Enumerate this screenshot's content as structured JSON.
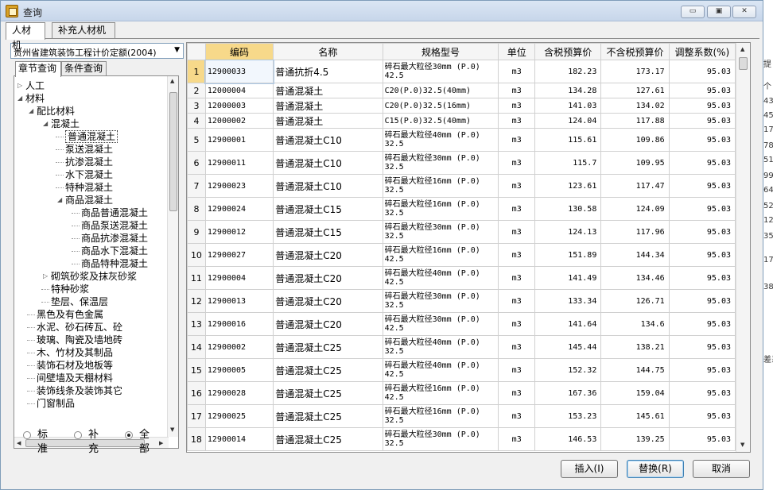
{
  "window": {
    "title": "查询",
    "controls": {
      "minimize": "▭",
      "maximize": "▣",
      "close": "✕"
    }
  },
  "top_tabs": [
    {
      "label": "人材机",
      "active": true
    },
    {
      "label": "补充人材机",
      "active": false
    }
  ],
  "left": {
    "dropdown_value": "贵州省建筑装饰工程计价定额(2004)",
    "sub_tabs": [
      {
        "label": "章节查询",
        "active": true
      },
      {
        "label": "条件查询",
        "active": false
      }
    ],
    "tree": [
      {
        "label": "人工",
        "level": 0,
        "expander": "▷"
      },
      {
        "label": "材料",
        "level": 0,
        "expander": "◢"
      },
      {
        "label": "配比材料",
        "level": 1,
        "expander": "◢"
      },
      {
        "label": "混凝土",
        "level": 2,
        "expander": "◢"
      },
      {
        "label": "普通混凝土",
        "level": 3,
        "expander": "",
        "selected": true
      },
      {
        "label": "泵送混凝土",
        "level": 3,
        "expander": ""
      },
      {
        "label": "抗渗混凝土",
        "level": 3,
        "expander": ""
      },
      {
        "label": "水下混凝土",
        "level": 3,
        "expander": ""
      },
      {
        "label": "特种混凝土",
        "level": 3,
        "expander": ""
      },
      {
        "label": "商品混凝土",
        "level": 3,
        "expander": "◢"
      },
      {
        "label": "商品普通混凝土",
        "level": 4,
        "expander": ""
      },
      {
        "label": "商品泵送混凝土",
        "level": 4,
        "expander": ""
      },
      {
        "label": "商品抗渗混凝土",
        "level": 4,
        "expander": ""
      },
      {
        "label": "商品水下混凝土",
        "level": 4,
        "expander": ""
      },
      {
        "label": "商品特种混凝土",
        "level": 4,
        "expander": ""
      },
      {
        "label": "砌筑砂浆及抹灰砂浆",
        "level": 2,
        "expander": "▷"
      },
      {
        "label": "特种砂浆",
        "level": 2,
        "expander": ""
      },
      {
        "label": "垫层、保温层",
        "level": 2,
        "expander": ""
      },
      {
        "label": "黑色及有色金属",
        "level": 1,
        "expander": ""
      },
      {
        "label": "水泥、砂石砖瓦、砼",
        "level": 1,
        "expander": ""
      },
      {
        "label": "玻璃、陶瓷及墙地砖",
        "level": 1,
        "expander": ""
      },
      {
        "label": "木、竹材及其制品",
        "level": 1,
        "expander": ""
      },
      {
        "label": "装饰石材及地板等",
        "level": 1,
        "expander": ""
      },
      {
        "label": "间壁墙及天棚材料",
        "level": 1,
        "expander": ""
      },
      {
        "label": "装饰线条及装饰其它",
        "level": 1,
        "expander": ""
      },
      {
        "label": "门窗制品",
        "level": 1,
        "expander": ""
      }
    ],
    "filter": [
      {
        "label": "标准",
        "checked": false
      },
      {
        "label": "补充",
        "checked": false
      },
      {
        "label": "全部",
        "checked": true
      }
    ]
  },
  "grid": {
    "columns": [
      "",
      "编码",
      "名称",
      "规格型号",
      "单位",
      "含税预算价",
      "不含税预算价",
      "调整系数(%)"
    ],
    "rows": [
      {
        "n": "1",
        "code": "12900033",
        "name": "普通抗折4.5",
        "spec": "碎石最大粒径30mm (P.0) 42.5",
        "unit": "m3",
        "tax": "182.23",
        "notax": "173.17",
        "coef": "95.03"
      },
      {
        "n": "2",
        "code": "12000004",
        "name": "普通混凝土",
        "spec": "C20(P.0)32.5(40mm)",
        "unit": "m3",
        "tax": "134.28",
        "notax": "127.61",
        "coef": "95.03"
      },
      {
        "n": "3",
        "code": "12000003",
        "name": "普通混凝土",
        "spec": "C20(P.0)32.5(16mm)",
        "unit": "m3",
        "tax": "141.03",
        "notax": "134.02",
        "coef": "95.03"
      },
      {
        "n": "4",
        "code": "12000002",
        "name": "普通混凝土",
        "spec": "C15(P.0)32.5(40mm)",
        "unit": "m3",
        "tax": "124.04",
        "notax": "117.88",
        "coef": "95.03"
      },
      {
        "n": "5",
        "code": "12900001",
        "name": "普通混凝土C10",
        "spec": "碎石最大粒径40mm (P.0) 32.5",
        "unit": "m3",
        "tax": "115.61",
        "notax": "109.86",
        "coef": "95.03"
      },
      {
        "n": "6",
        "code": "12900011",
        "name": "普通混凝土C10",
        "spec": "碎石最大粒径30mm (P.0) 32.5",
        "unit": "m3",
        "tax": "115.7",
        "notax": "109.95",
        "coef": "95.03"
      },
      {
        "n": "7",
        "code": "12900023",
        "name": "普通混凝土C10",
        "spec": "碎石最大粒径16mm (P.0) 32.5",
        "unit": "m3",
        "tax": "123.61",
        "notax": "117.47",
        "coef": "95.03"
      },
      {
        "n": "8",
        "code": "12900024",
        "name": "普通混凝土C15",
        "spec": "碎石最大粒径16mm (P.0) 32.5",
        "unit": "m3",
        "tax": "130.58",
        "notax": "124.09",
        "coef": "95.03"
      },
      {
        "n": "9",
        "code": "12900012",
        "name": "普通混凝土C15",
        "spec": "碎石最大粒径30mm (P.0) 32.5",
        "unit": "m3",
        "tax": "124.13",
        "notax": "117.96",
        "coef": "95.03"
      },
      {
        "n": "10",
        "code": "12900027",
        "name": "普通混凝土C20",
        "spec": "碎石最大粒径16mm (P.0) 42.5",
        "unit": "m3",
        "tax": "151.89",
        "notax": "144.34",
        "coef": "95.03"
      },
      {
        "n": "11",
        "code": "12900004",
        "name": "普通混凝土C20",
        "spec": "碎石最大粒径40mm (P.0) 42.5",
        "unit": "m3",
        "tax": "141.49",
        "notax": "134.46",
        "coef": "95.03"
      },
      {
        "n": "12",
        "code": "12900013",
        "name": "普通混凝土C20",
        "spec": "碎石最大粒径30mm (P.0) 32.5",
        "unit": "m3",
        "tax": "133.34",
        "notax": "126.71",
        "coef": "95.03"
      },
      {
        "n": "13",
        "code": "12900016",
        "name": "普通混凝土C20",
        "spec": "碎石最大粒径30mm (P.0) 42.5",
        "unit": "m3",
        "tax": "141.64",
        "notax": "134.6",
        "coef": "95.03"
      },
      {
        "n": "14",
        "code": "12900002",
        "name": "普通混凝土C25",
        "spec": "碎石最大粒径40mm (P.0) 32.5",
        "unit": "m3",
        "tax": "145.44",
        "notax": "138.21",
        "coef": "95.03"
      },
      {
        "n": "15",
        "code": "12900005",
        "name": "普通混凝土C25",
        "spec": "碎石最大粒径40mm (P.0) 42.5",
        "unit": "m3",
        "tax": "152.32",
        "notax": "144.75",
        "coef": "95.03"
      },
      {
        "n": "16",
        "code": "12900028",
        "name": "普通混凝土C25",
        "spec": "碎石最大粒径16mm (P.0) 42.5",
        "unit": "m3",
        "tax": "167.36",
        "notax": "159.04",
        "coef": "95.03"
      },
      {
        "n": "17",
        "code": "12900025",
        "name": "普通混凝土C25",
        "spec": "碎石最大粒径16mm (P.0) 32.5",
        "unit": "m3",
        "tax": "153.23",
        "notax": "145.61",
        "coef": "95.03"
      },
      {
        "n": "18",
        "code": "12900014",
        "name": "普通混凝土C25",
        "spec": "碎石最大粒径30mm (P.0) 32.5",
        "unit": "m3",
        "tax": "146.53",
        "notax": "139.25",
        "coef": "95.03"
      }
    ]
  },
  "buttons": {
    "insert": "插入(I)",
    "replace": "替换(R)",
    "cancel": "取消"
  },
  "background_strip": [
    "提",
    "个",
    "43",
    "45",
    "17",
    "78",
    "51",
    "99",
    "64",
    "52",
    "12",
    "35",
    "17",
    "38",
    "差系"
  ],
  "colors": {
    "header_active": "#f7d98a",
    "title_gradient_top": "#dbe6f4",
    "border": "#7f9db9"
  }
}
